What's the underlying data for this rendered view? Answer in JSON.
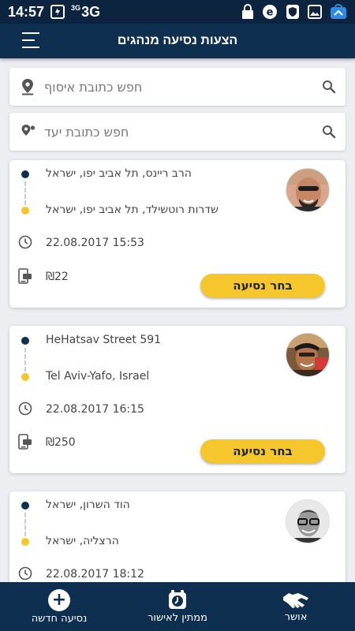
{
  "status_bar": {
    "time": "14:57",
    "network": "3G",
    "network_small": "3G"
  },
  "header": {
    "title": "הצעות נסיעה מנהגים"
  },
  "search": {
    "pickup_placeholder": "חפש כתובת איסוף",
    "destination_placeholder": "חפש כתובת יעד"
  },
  "rides": [
    {
      "origin": "הרב ריינס, תל אביב יפו, ישראל",
      "destination": "שדרות רוטשילד, תל אביב יפו, ישראל",
      "datetime": "22.08.2017 15:53",
      "price": "₪22",
      "button": "בחר נסיעה"
    },
    {
      "origin": "HeHatsav Street 591",
      "destination": "Tel Aviv-Yafo, Israel",
      "datetime": "22.08.2017 16:15",
      "price": "₪250",
      "button": "בחר נסיעה"
    },
    {
      "origin": "הוד השרון, ישראל",
      "destination": "הרצליה, ישראל",
      "datetime": "22.08.2017 18:12"
    }
  ],
  "bottom_nav": {
    "new_ride": "נסיעה חדשה",
    "pending": "ממתין לאישור",
    "approved": "אושר"
  },
  "colors": {
    "primary": "#0f2f50",
    "accent": "#f6c72d",
    "background": "#eceef2"
  }
}
